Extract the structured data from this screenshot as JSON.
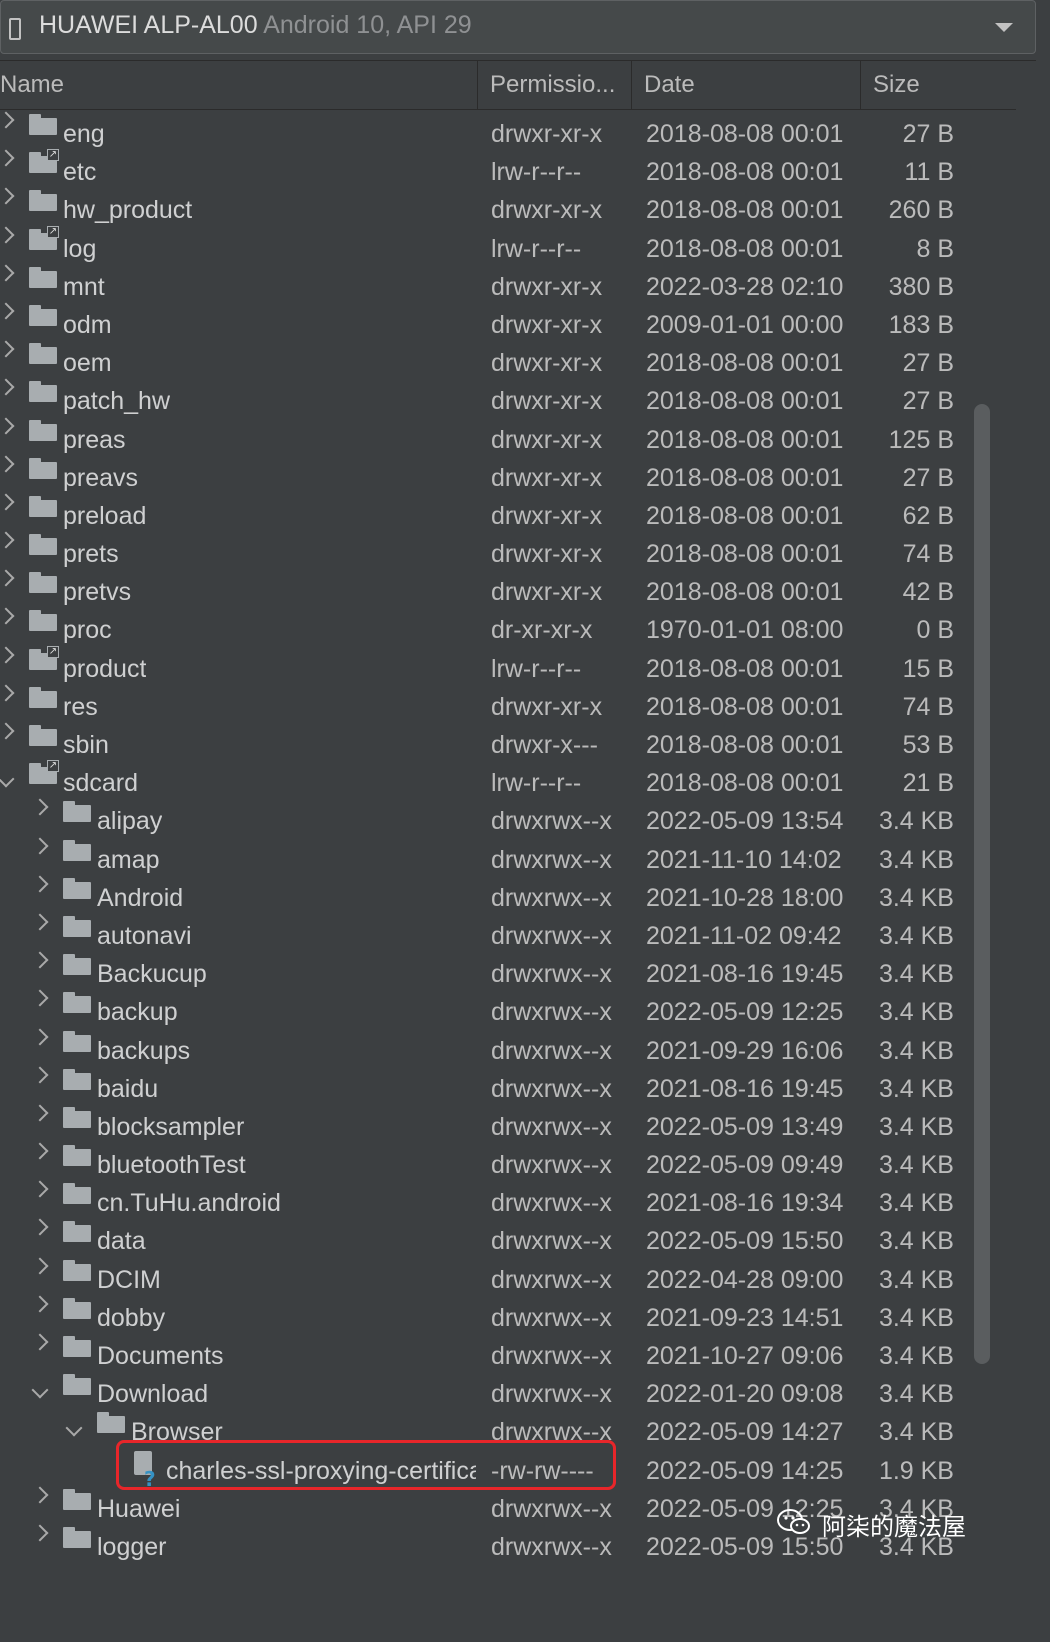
{
  "device_selector": {
    "device_name": "HUAWEI ALP-AL00",
    "device_api": "Android 10, API 29"
  },
  "columns": {
    "name": "Name",
    "permissions": "Permissio...",
    "date": "Date",
    "size": "Size"
  },
  "rows": [
    {
      "name": "eng",
      "perm": "drwxr-xr-x",
      "date": "2018-08-08 00:01",
      "size": "27 B",
      "depth": 0,
      "type": "folder",
      "expanded": false
    },
    {
      "name": "etc",
      "perm": "lrw-r--r--",
      "date": "2018-08-08 00:01",
      "size": "11 B",
      "depth": 0,
      "type": "link",
      "expanded": false
    },
    {
      "name": "hw_product",
      "perm": "drwxr-xr-x",
      "date": "2018-08-08 00:01",
      "size": "260 B",
      "depth": 0,
      "type": "folder",
      "expanded": false
    },
    {
      "name": "log",
      "perm": "lrw-r--r--",
      "date": "2018-08-08 00:01",
      "size": "8 B",
      "depth": 0,
      "type": "link",
      "expanded": false
    },
    {
      "name": "mnt",
      "perm": "drwxr-xr-x",
      "date": "2022-03-28 02:10",
      "size": "380 B",
      "depth": 0,
      "type": "folder",
      "expanded": false
    },
    {
      "name": "odm",
      "perm": "drwxr-xr-x",
      "date": "2009-01-01 00:00",
      "size": "183 B",
      "depth": 0,
      "type": "folder",
      "expanded": false
    },
    {
      "name": "oem",
      "perm": "drwxr-xr-x",
      "date": "2018-08-08 00:01",
      "size": "27 B",
      "depth": 0,
      "type": "folder",
      "expanded": false
    },
    {
      "name": "patch_hw",
      "perm": "drwxr-xr-x",
      "date": "2018-08-08 00:01",
      "size": "27 B",
      "depth": 0,
      "type": "folder",
      "expanded": false
    },
    {
      "name": "preas",
      "perm": "drwxr-xr-x",
      "date": "2018-08-08 00:01",
      "size": "125 B",
      "depth": 0,
      "type": "folder",
      "expanded": false
    },
    {
      "name": "preavs",
      "perm": "drwxr-xr-x",
      "date": "2018-08-08 00:01",
      "size": "27 B",
      "depth": 0,
      "type": "folder",
      "expanded": false
    },
    {
      "name": "preload",
      "perm": "drwxr-xr-x",
      "date": "2018-08-08 00:01",
      "size": "62 B",
      "depth": 0,
      "type": "folder",
      "expanded": false
    },
    {
      "name": "prets",
      "perm": "drwxr-xr-x",
      "date": "2018-08-08 00:01",
      "size": "74 B",
      "depth": 0,
      "type": "folder",
      "expanded": false
    },
    {
      "name": "pretvs",
      "perm": "drwxr-xr-x",
      "date": "2018-08-08 00:01",
      "size": "42 B",
      "depth": 0,
      "type": "folder",
      "expanded": false
    },
    {
      "name": "proc",
      "perm": "dr-xr-xr-x",
      "date": "1970-01-01 08:00",
      "size": "0 B",
      "depth": 0,
      "type": "folder",
      "expanded": false
    },
    {
      "name": "product",
      "perm": "lrw-r--r--",
      "date": "2018-08-08 00:01",
      "size": "15 B",
      "depth": 0,
      "type": "link",
      "expanded": false
    },
    {
      "name": "res",
      "perm": "drwxr-xr-x",
      "date": "2018-08-08 00:01",
      "size": "74 B",
      "depth": 0,
      "type": "folder",
      "expanded": false
    },
    {
      "name": "sbin",
      "perm": "drwxr-x---",
      "date": "2018-08-08 00:01",
      "size": "53 B",
      "depth": 0,
      "type": "folder",
      "expanded": false
    },
    {
      "name": "sdcard",
      "perm": "lrw-r--r--",
      "date": "2018-08-08 00:01",
      "size": "21 B",
      "depth": 0,
      "type": "link",
      "expanded": true
    },
    {
      "name": "alipay",
      "perm": "drwxrwx--x",
      "date": "2022-05-09 13:54",
      "size": "3.4 KB",
      "depth": 1,
      "type": "folder",
      "expanded": false
    },
    {
      "name": "amap",
      "perm": "drwxrwx--x",
      "date": "2021-11-10 14:02",
      "size": "3.4 KB",
      "depth": 1,
      "type": "folder",
      "expanded": false
    },
    {
      "name": "Android",
      "perm": "drwxrwx--x",
      "date": "2021-10-28 18:00",
      "size": "3.4 KB",
      "depth": 1,
      "type": "folder",
      "expanded": false
    },
    {
      "name": "autonavi",
      "perm": "drwxrwx--x",
      "date": "2021-11-02 09:42",
      "size": "3.4 KB",
      "depth": 1,
      "type": "folder",
      "expanded": false
    },
    {
      "name": "Backucup",
      "perm": "drwxrwx--x",
      "date": "2021-08-16 19:45",
      "size": "3.4 KB",
      "depth": 1,
      "type": "folder",
      "expanded": false
    },
    {
      "name": "backup",
      "perm": "drwxrwx--x",
      "date": "2022-05-09 12:25",
      "size": "3.4 KB",
      "depth": 1,
      "type": "folder",
      "expanded": false
    },
    {
      "name": "backups",
      "perm": "drwxrwx--x",
      "date": "2021-09-29 16:06",
      "size": "3.4 KB",
      "depth": 1,
      "type": "folder",
      "expanded": false
    },
    {
      "name": "baidu",
      "perm": "drwxrwx--x",
      "date": "2021-08-16 19:45",
      "size": "3.4 KB",
      "depth": 1,
      "type": "folder",
      "expanded": false
    },
    {
      "name": "blocksampler",
      "perm": "drwxrwx--x",
      "date": "2022-05-09 13:49",
      "size": "3.4 KB",
      "depth": 1,
      "type": "folder",
      "expanded": false
    },
    {
      "name": "bluetoothTest",
      "perm": "drwxrwx--x",
      "date": "2022-05-09 09:49",
      "size": "3.4 KB",
      "depth": 1,
      "type": "folder",
      "expanded": false
    },
    {
      "name": "cn.TuHu.android",
      "perm": "drwxrwx--x",
      "date": "2021-08-16 19:34",
      "size": "3.4 KB",
      "depth": 1,
      "type": "folder",
      "expanded": false
    },
    {
      "name": "data",
      "perm": "drwxrwx--x",
      "date": "2022-05-09 15:50",
      "size": "3.4 KB",
      "depth": 1,
      "type": "folder",
      "expanded": false
    },
    {
      "name": "DCIM",
      "perm": "drwxrwx--x",
      "date": "2022-04-28 09:00",
      "size": "3.4 KB",
      "depth": 1,
      "type": "folder",
      "expanded": false
    },
    {
      "name": "dobby",
      "perm": "drwxrwx--x",
      "date": "2021-09-23 14:51",
      "size": "3.4 KB",
      "depth": 1,
      "type": "folder",
      "expanded": false
    },
    {
      "name": "Documents",
      "perm": "drwxrwx--x",
      "date": "2021-10-27 09:06",
      "size": "3.4 KB",
      "depth": 1,
      "type": "folder",
      "expanded": false
    },
    {
      "name": "Download",
      "perm": "drwxrwx--x",
      "date": "2022-01-20 09:08",
      "size": "3.4 KB",
      "depth": 1,
      "type": "folder",
      "expanded": true
    },
    {
      "name": "Browser",
      "perm": "drwxrwx--x",
      "date": "2022-05-09 14:27",
      "size": "3.4 KB",
      "depth": 2,
      "type": "folder",
      "expanded": true
    },
    {
      "name": "charles-ssl-proxying-certifica",
      "perm": "-rw-rw----",
      "date": "2022-05-09 14:25",
      "size": "1.9 KB",
      "depth": 3,
      "type": "file",
      "expanded": false
    },
    {
      "name": "Huawei",
      "perm": "drwxrwx--x",
      "date": "2022-05-09 12:25",
      "size": "3.4 KB",
      "depth": 1,
      "type": "folder",
      "expanded": false
    },
    {
      "name": "logger",
      "perm": "drwxrwx--x",
      "date": "2022-05-09 15:50",
      "size": "3.4 KB",
      "depth": 1,
      "type": "folder",
      "expanded": false
    }
  ],
  "watermark": {
    "text": "阿柒的魔法屋",
    "icon": "wechat-icon"
  },
  "colors": {
    "background": "#3c3f41",
    "text": "#bbbbbb",
    "highlight": "#e8262a"
  }
}
